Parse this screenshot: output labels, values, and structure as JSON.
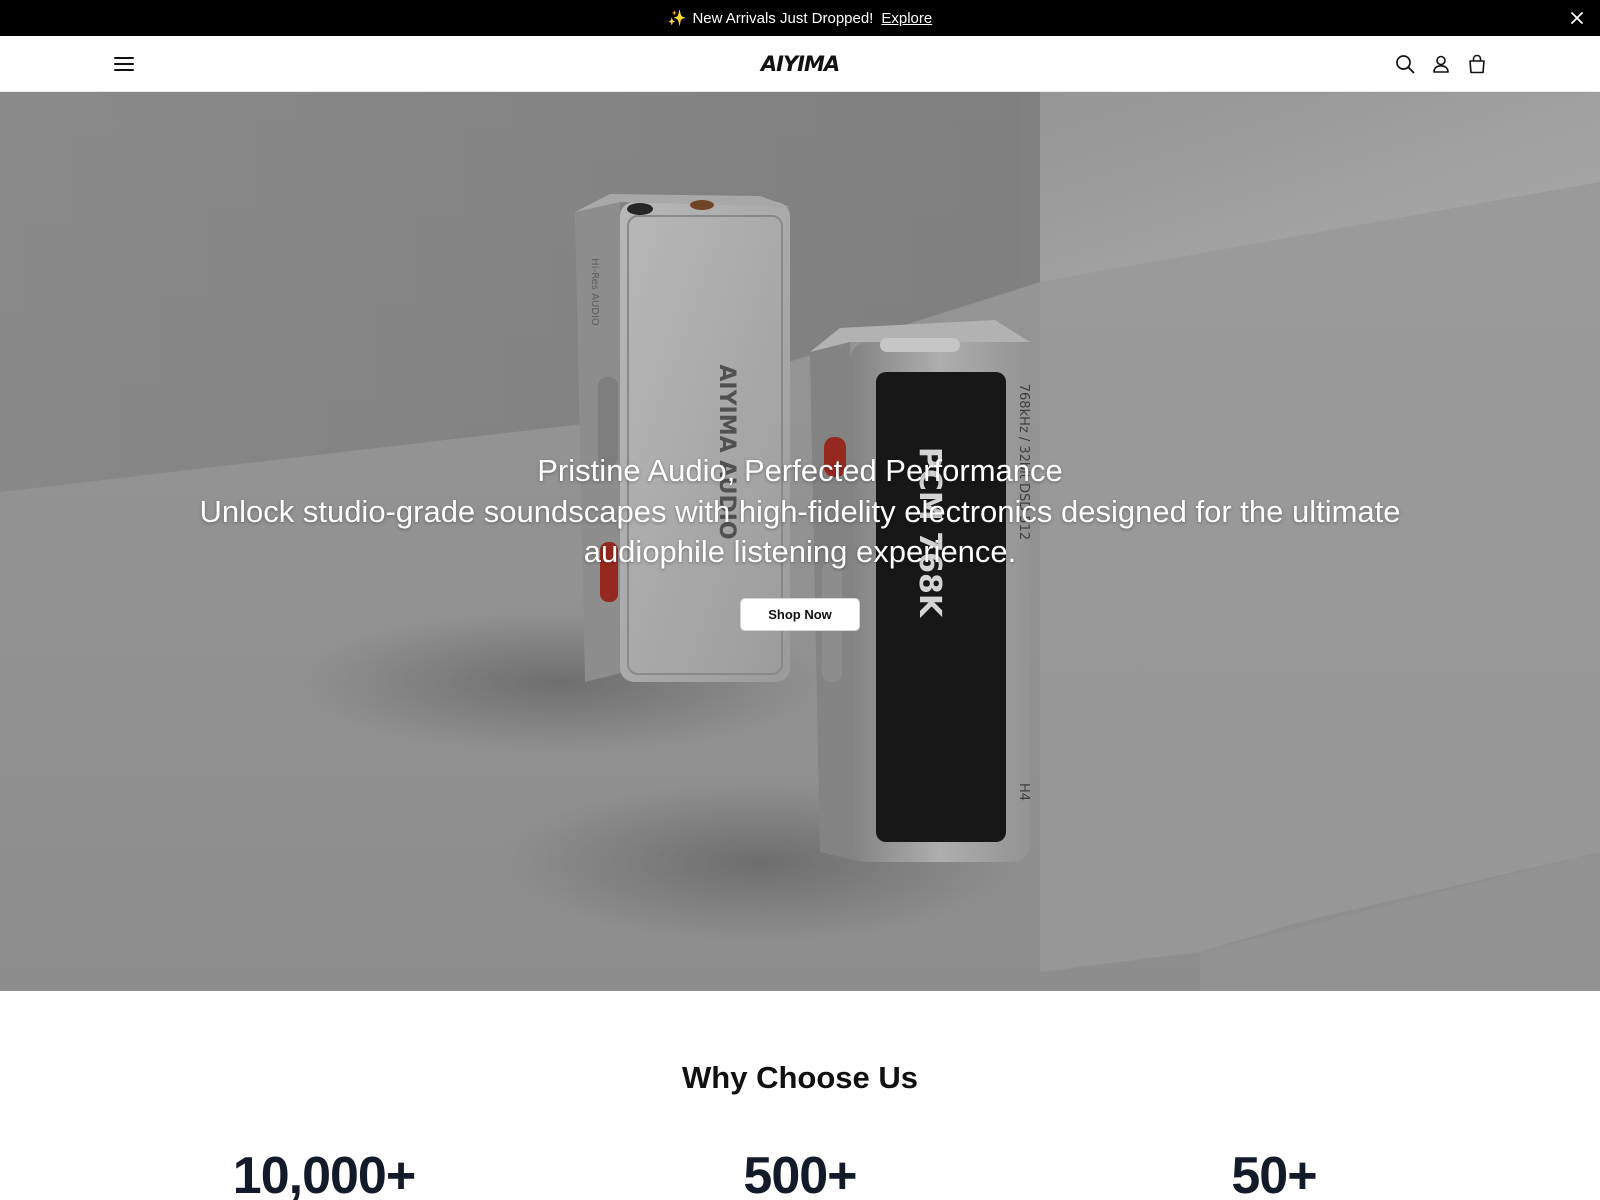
{
  "announcement": {
    "text": "New Arrivals Just Dropped!",
    "link": "Explore",
    "icon": "sparkle-icon",
    "close_icon": "close-icon"
  },
  "header": {
    "brand": "AIYIMA",
    "menu_icon": "hamburger-menu-icon",
    "search_icon": "search-icon",
    "account_icon": "user-icon",
    "cart_icon": "shopping-bag-icon"
  },
  "hero": {
    "title": "Pristine Audio, Perfected Performance",
    "subtitle": "Unlock studio-grade soundscapes with high-fidelity electronics designed for the ultimate audiophile listening experience.",
    "cta": "Shop Now",
    "product_print": {
      "back_device": [
        "Hi-Res AUDIO",
        "AIYIMA AUDIO"
      ],
      "front_device_side": "768kHz / 32bit DSD 512",
      "front_device_model": "H4",
      "front_device_screen": "PCM 768K"
    }
  },
  "why": {
    "title": "Why Choose Us",
    "stats": [
      "10,000+",
      "500+",
      "50+"
    ]
  },
  "colors": {
    "announcement_bg": "#000000",
    "accent_sparkle": "#f5c400",
    "stat_text": "#131a2a"
  }
}
